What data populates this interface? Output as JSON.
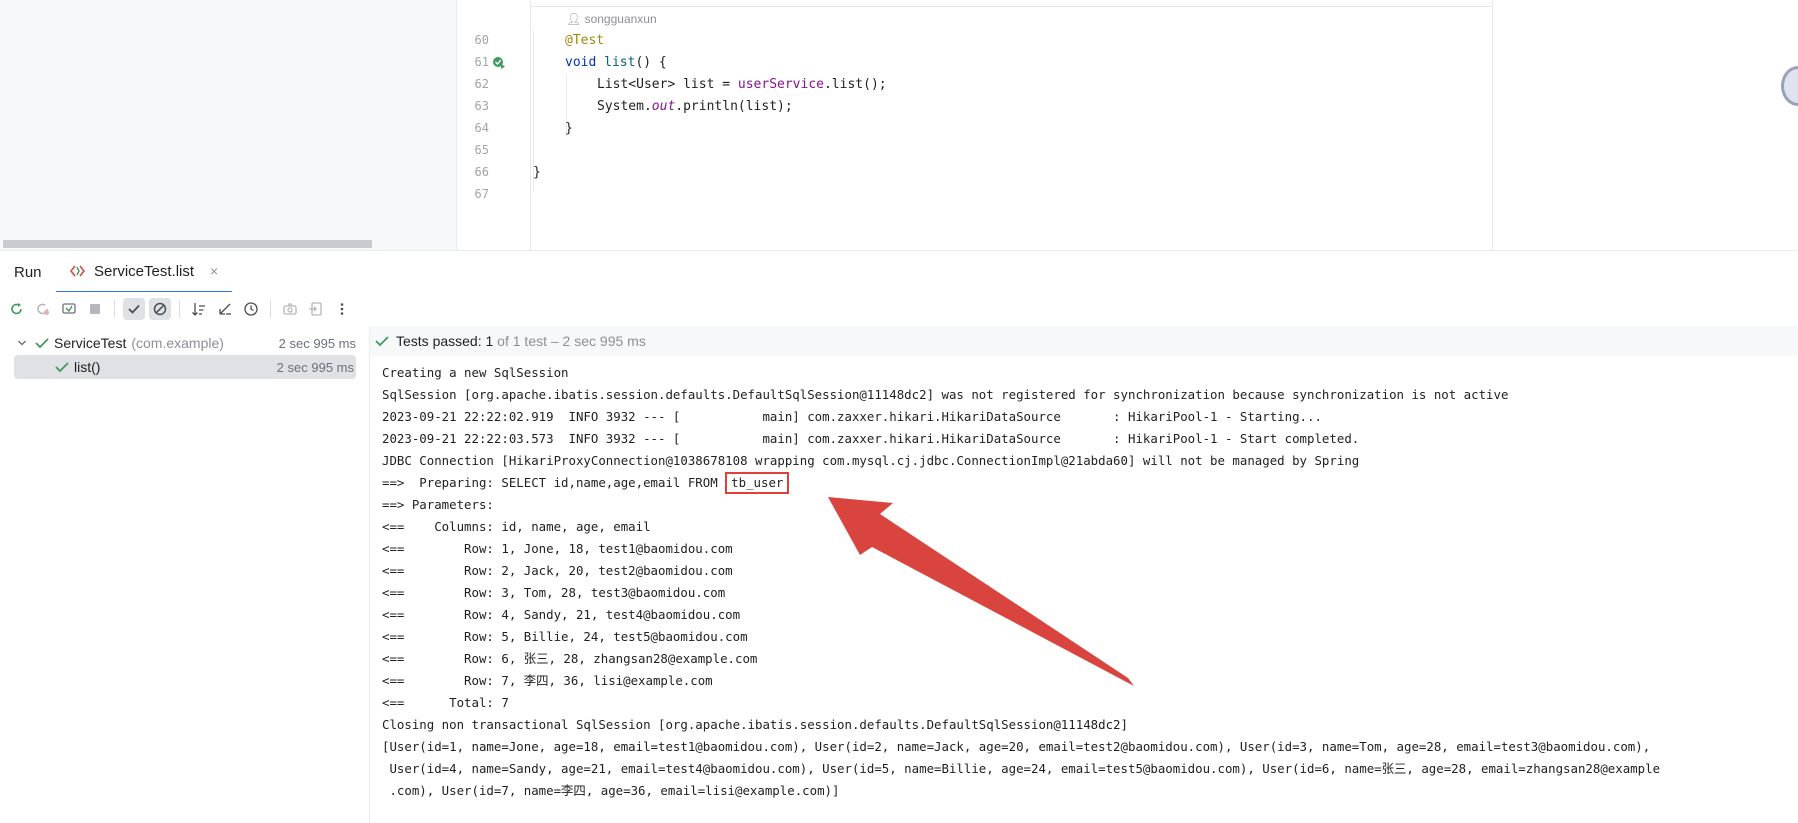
{
  "editor": {
    "author": "songguanxun",
    "line_numbers": [
      "60",
      "61",
      "62",
      "63",
      "64",
      "65",
      "66",
      "67"
    ],
    "code": {
      "annotation": "@Test",
      "method_kw": "void",
      "method_name": "list",
      "method_rest": "() {",
      "line62_type": "List<User> list = ",
      "line62_field": "userService",
      "line62_call": ".list();",
      "line63_a": "System.",
      "line63_field": "out",
      "line63_b": ".println(list);",
      "close_method": "}",
      "close_class": "}"
    }
  },
  "run_window": {
    "title": "Run",
    "tab_label": "ServiceTest.list",
    "tab_close": "×"
  },
  "toolbar": {
    "icons": [
      "rerun-icon",
      "rerun-failed-icon",
      "rerun-toggle-icon",
      "stop-icon",
      "show-passed-icon",
      "show-ignored-icon",
      "sort-alpha-icon",
      "sort-duration-icon",
      "history-icon",
      "screenshot-icon",
      "export-icon",
      "more-icon"
    ]
  },
  "tree": {
    "root_label": "ServiceTest",
    "root_package": "(com.example)",
    "root_time": "2 sec 995 ms",
    "child_label": "list()",
    "child_time": "2 sec 995 ms"
  },
  "status": {
    "prefix": "Tests passed: ",
    "count": "1",
    "suffix": " of 1 test – 2 sec 995 ms"
  },
  "console": {
    "lines": [
      "Creating a new SqlSession",
      "SqlSession [org.apache.ibatis.session.defaults.DefaultSqlSession@11148dc2] was not registered for synchronization because synchronization is not active",
      "2023-09-21 22:22:02.919  INFO 3932 --- [           main] com.zaxxer.hikari.HikariDataSource       : HikariPool-1 - Starting...",
      "2023-09-21 22:22:03.573  INFO 3932 --- [           main] com.zaxxer.hikari.HikariDataSource       : HikariPool-1 - Start completed.",
      "JDBC Connection [HikariProxyConnection@1038678108 wrapping com.mysql.cj.jdbc.ConnectionImpl@21abda60] will not be managed by Spring"
    ],
    "preparing_prefix": "==>  Preparing: SELECT id,name,age,email FROM ",
    "preparing_table": "tb_user",
    "lines_after": [
      "==> Parameters: ",
      "<==    Columns: id, name, age, email",
      "<==        Row: 1, Jone, 18, test1@baomidou.com",
      "<==        Row: 2, Jack, 20, test2@baomidou.com",
      "<==        Row: 3, Tom, 28, test3@baomidou.com",
      "<==        Row: 4, Sandy, 21, test4@baomidou.com",
      "<==        Row: 5, Billie, 24, test5@baomidou.com",
      "<==        Row: 6, 张三, 28, zhangsan28@example.com",
      "<==        Row: 7, 李四, 36, lisi@example.com",
      "<==      Total: 7",
      "Closing non transactional SqlSession [org.apache.ibatis.session.defaults.DefaultSqlSession@11148dc2]",
      "[User(id=1, name=Jone, age=18, email=test1@baomidou.com), User(id=2, name=Jack, age=20, email=test2@baomidou.com), User(id=3, name=Tom, age=28, email=test3@baomidou.com),",
      " User(id=4, name=Sandy, age=21, email=test4@baomidou.com), User(id=5, name=Billie, age=24, email=test5@baomidou.com), User(id=6, name=张三, age=28, email=zhangsan28@example",
      " .com), User(id=7, name=李四, age=36, email=lisi@example.com)]"
    ]
  },
  "colors": {
    "accent": "#3574f0",
    "pass_green": "#3f9b5c",
    "annotation_red": "#e23f3a"
  }
}
